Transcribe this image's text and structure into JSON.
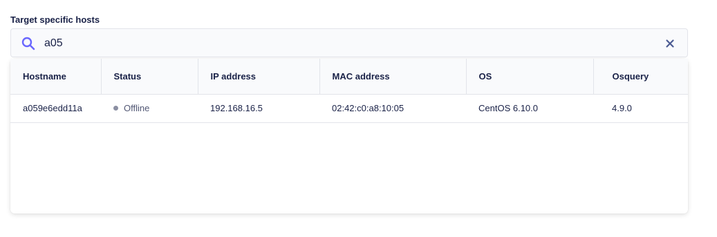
{
  "section": {
    "label": "Target specific hosts"
  },
  "search": {
    "value": "a05",
    "placeholder": ""
  },
  "colors": {
    "accent": "#6a67fe",
    "text": "#192147",
    "offline_dot": "#8b8fa2",
    "border": "#e2e4ea"
  },
  "icons": {
    "search": "search-icon",
    "clear": "close-icon",
    "status": "status-dot-icon"
  },
  "table": {
    "columns": [
      "Hostname",
      "Status",
      "IP address",
      "MAC address",
      "OS",
      "Osquery"
    ],
    "rows": [
      {
        "hostname": "a059e6edd11a",
        "status": "Offline",
        "ip": "192.168.16.5",
        "mac": "02:42:c0:a8:10:05",
        "os": "CentOS 6.10.0",
        "osquery": "4.9.0"
      }
    ]
  }
}
